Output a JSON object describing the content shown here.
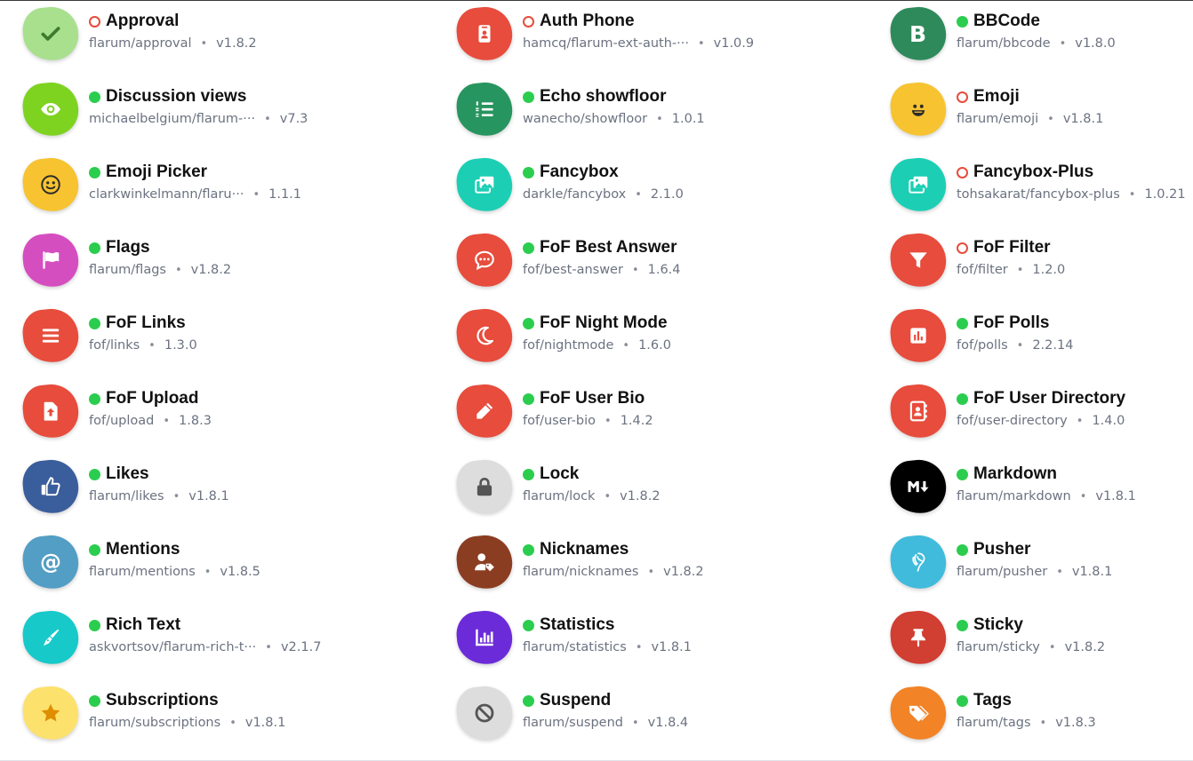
{
  "extensions": [
    {
      "title": "Approval",
      "package": "flarum/approval",
      "version": "v1.8.2",
      "enabled": false,
      "icon": "check-icon",
      "color": "#a8e08e",
      "fg": "#3f7a2f",
      "col": 0,
      "row": 0
    },
    {
      "title": "Auth Phone",
      "package": "hamcq/flarum-ext-auth-···",
      "version": "v1.0.9",
      "enabled": false,
      "icon": "id-badge-icon",
      "color": "#e74c3c",
      "fg": "#ffffff",
      "col": 1,
      "row": 0
    },
    {
      "title": "BBCode",
      "package": "flarum/bbcode",
      "version": "v1.8.0",
      "enabled": true,
      "icon": "bold-icon",
      "color": "#2f8a5b",
      "fg": "#ffffff",
      "col": 2,
      "row": 0
    },
    {
      "title": "Discussion views",
      "package": "michaelbelgium/flarum-···",
      "version": "v7.3",
      "enabled": true,
      "icon": "eye-icon",
      "color": "#7ed321",
      "fg": "#ffffff",
      "col": 0,
      "row": 1
    },
    {
      "title": "Echo showfloor",
      "package": "wanecho/showfloor",
      "version": "1.0.1",
      "enabled": true,
      "icon": "list-ol-icon",
      "color": "#27955f",
      "fg": "#ffffff",
      "col": 1,
      "row": 1
    },
    {
      "title": "Emoji",
      "package": "flarum/emoji",
      "version": "v1.8.1",
      "enabled": false,
      "icon": "laugh-icon",
      "color": "#f7c331",
      "fg": "#2b2b2b",
      "col": 2,
      "row": 1
    },
    {
      "title": "Emoji Picker",
      "package": "clarkwinkelmann/flaru···",
      "version": "1.1.1",
      "enabled": true,
      "icon": "smile-icon",
      "color": "#f7c331",
      "fg": "#2b2b2b",
      "col": 0,
      "row": 2
    },
    {
      "title": "Fancybox",
      "package": "darkle/fancybox",
      "version": "2.1.0",
      "enabled": true,
      "icon": "images-icon",
      "color": "#1ccfb4",
      "fg": "#ffffff",
      "col": 1,
      "row": 2
    },
    {
      "title": "Fancybox-Plus",
      "package": "tohsakarat/fancybox-plus",
      "version": "1.0.21",
      "enabled": false,
      "icon": "images-icon",
      "color": "#1ccfb4",
      "fg": "#ffffff",
      "col": 2,
      "row": 2
    },
    {
      "title": "Flags",
      "package": "flarum/flags",
      "version": "v1.8.2",
      "enabled": true,
      "icon": "flag-icon",
      "color": "#d54ec0",
      "fg": "#ffffff",
      "col": 0,
      "row": 3
    },
    {
      "title": "FoF Best Answer",
      "package": "fof/best-answer",
      "version": "1.6.4",
      "enabled": true,
      "icon": "comment-dots-icon",
      "color": "#e74c3c",
      "fg": "#ffffff",
      "col": 1,
      "row": 3
    },
    {
      "title": "FoF Filter",
      "package": "fof/filter",
      "version": "1.2.0",
      "enabled": false,
      "icon": "filter-icon",
      "color": "#e74c3c",
      "fg": "#ffffff",
      "col": 2,
      "row": 3
    },
    {
      "title": "FoF Links",
      "package": "fof/links",
      "version": "1.3.0",
      "enabled": true,
      "icon": "bars-icon",
      "color": "#e74c3c",
      "fg": "#ffffff",
      "col": 0,
      "row": 4
    },
    {
      "title": "FoF Night Mode",
      "package": "fof/nightmode",
      "version": "1.6.0",
      "enabled": true,
      "icon": "moon-icon",
      "color": "#e74c3c",
      "fg": "#ffffff",
      "col": 1,
      "row": 4
    },
    {
      "title": "FoF Polls",
      "package": "fof/polls",
      "version": "2.2.14",
      "enabled": true,
      "icon": "poll-icon",
      "color": "#e74c3c",
      "fg": "#ffffff",
      "col": 2,
      "row": 4
    },
    {
      "title": "FoF Upload",
      "package": "fof/upload",
      "version": "1.8.3",
      "enabled": true,
      "icon": "file-upload-icon",
      "color": "#e74c3c",
      "fg": "#ffffff",
      "col": 0,
      "row": 5
    },
    {
      "title": "FoF User Bio",
      "package": "fof/user-bio",
      "version": "1.4.2",
      "enabled": true,
      "icon": "pencil-icon",
      "color": "#e74c3c",
      "fg": "#ffffff",
      "col": 1,
      "row": 5
    },
    {
      "title": "FoF User Directory",
      "package": "fof/user-directory",
      "version": "1.4.0",
      "enabled": true,
      "icon": "address-book-icon",
      "color": "#e74c3c",
      "fg": "#ffffff",
      "col": 2,
      "row": 5
    },
    {
      "title": "Likes",
      "package": "flarum/likes",
      "version": "v1.8.1",
      "enabled": true,
      "icon": "thumbs-up-icon",
      "color": "#3a5d9c",
      "fg": "#ffffff",
      "col": 0,
      "row": 6
    },
    {
      "title": "Lock",
      "package": "flarum/lock",
      "version": "v1.8.2",
      "enabled": true,
      "icon": "lock-icon",
      "color": "#dddddd",
      "fg": "#555555",
      "col": 1,
      "row": 6
    },
    {
      "title": "Markdown",
      "package": "flarum/markdown",
      "version": "v1.8.1",
      "enabled": true,
      "icon": "markdown-icon",
      "color": "#000000",
      "fg": "#ffffff",
      "col": 2,
      "row": 6
    },
    {
      "title": "Mentions",
      "package": "flarum/mentions",
      "version": "v1.8.5",
      "enabled": true,
      "icon": "at-icon",
      "color": "#539ec5",
      "fg": "#ffffff",
      "col": 0,
      "row": 7
    },
    {
      "title": "Nicknames",
      "package": "flarum/nicknames",
      "version": "v1.8.2",
      "enabled": true,
      "icon": "user-tag-icon",
      "color": "#8b3d22",
      "fg": "#ffffff",
      "col": 1,
      "row": 7
    },
    {
      "title": "Pusher",
      "package": "flarum/pusher",
      "version": "v1.8.1",
      "enabled": true,
      "icon": "pusher-icon",
      "color": "#40bbdb",
      "fg": "#ffffff",
      "col": 2,
      "row": 7
    },
    {
      "title": "Rich Text",
      "package": "askvortsov/flarum-rich-t···",
      "version": "v2.1.7",
      "enabled": true,
      "icon": "pen-nib-icon",
      "color": "#17c9c9",
      "fg": "#ffffff",
      "col": 0,
      "row": 8
    },
    {
      "title": "Statistics",
      "package": "flarum/statistics",
      "version": "v1.8.1",
      "enabled": true,
      "icon": "chart-bar-icon",
      "color": "#6c2bd9",
      "fg": "#ffffff",
      "col": 1,
      "row": 8
    },
    {
      "title": "Sticky",
      "package": "flarum/sticky",
      "version": "v1.8.2",
      "enabled": true,
      "icon": "thumbtack-icon",
      "color": "#d13e32",
      "fg": "#ffffff",
      "col": 2,
      "row": 8
    },
    {
      "title": "Subscriptions",
      "package": "flarum/subscriptions",
      "version": "v1.8.1",
      "enabled": true,
      "icon": "star-icon",
      "color": "#fde16d",
      "fg": "#de8e00",
      "col": 0,
      "row": 9
    },
    {
      "title": "Suspend",
      "package": "flarum/suspend",
      "version": "v1.8.4",
      "enabled": true,
      "icon": "ban-icon",
      "color": "#dddddd",
      "fg": "#555555",
      "col": 1,
      "row": 9
    },
    {
      "title": "Tags",
      "package": "flarum/tags",
      "version": "v1.8.3",
      "enabled": true,
      "icon": "tags-icon",
      "color": "#f28326",
      "fg": "#ffffff",
      "col": 2,
      "row": 9
    }
  ]
}
